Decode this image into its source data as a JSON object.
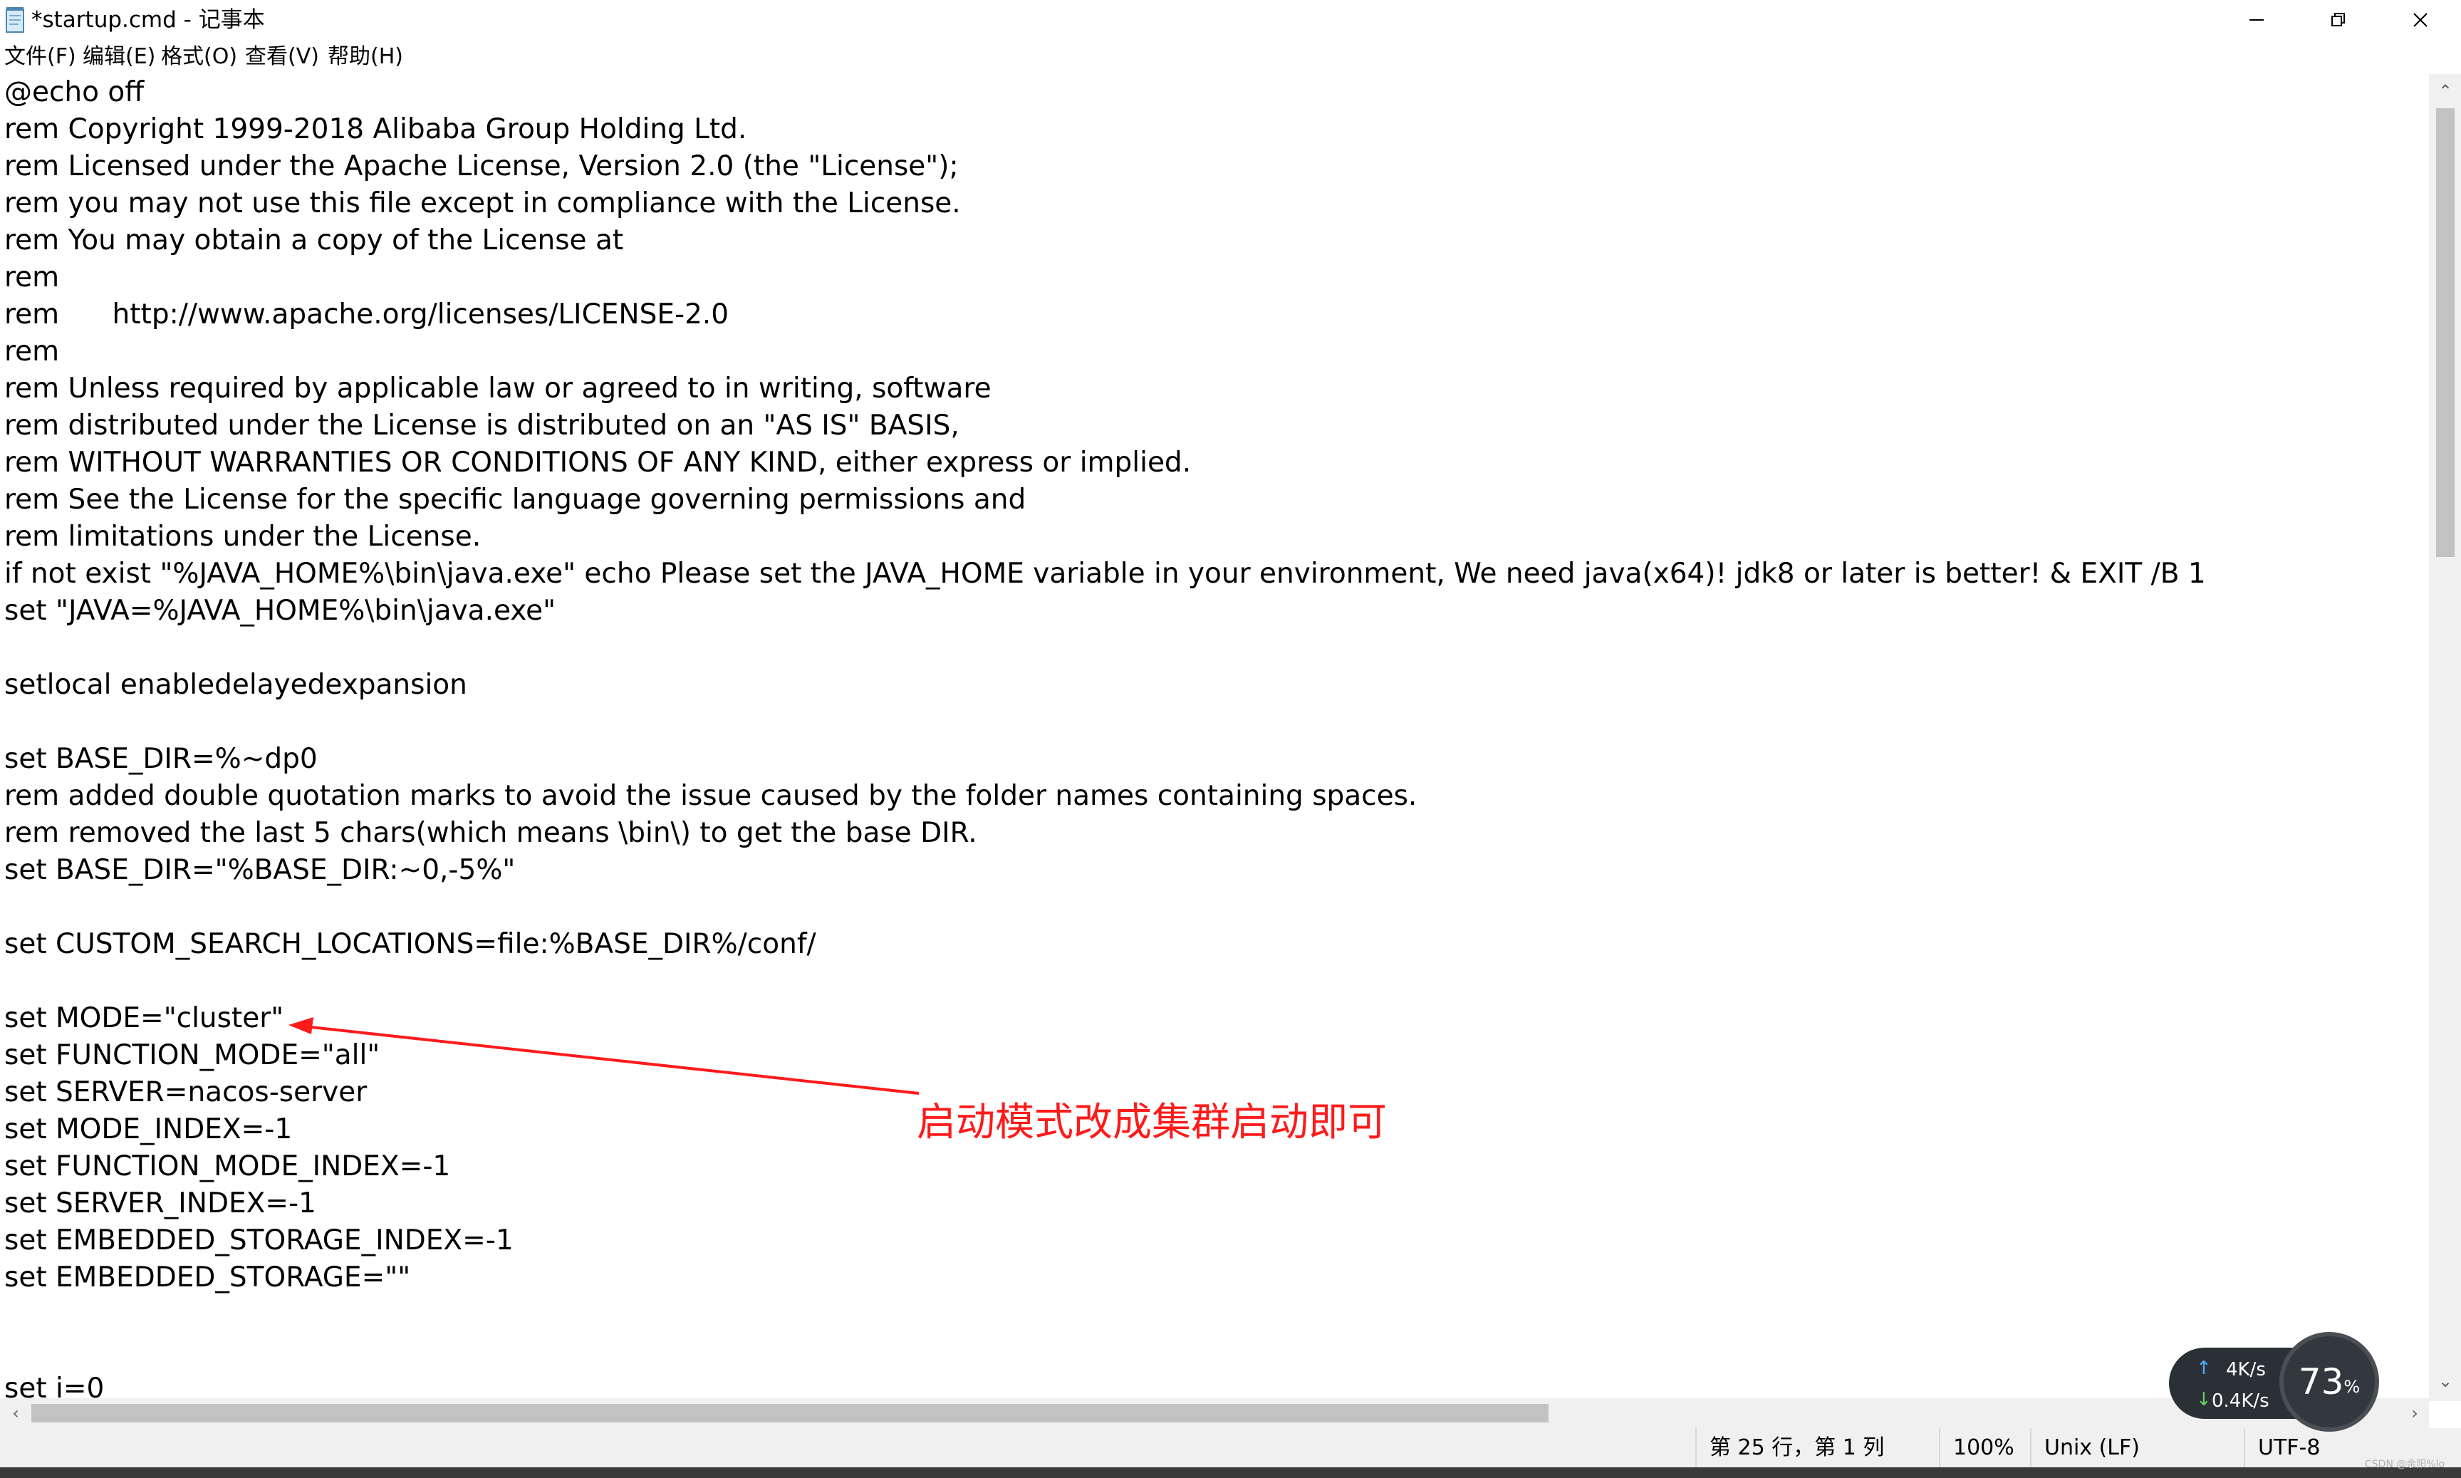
{
  "window": {
    "title": "*startup.cmd - 记事本",
    "minimize_glyph": "—",
    "maximize_glyph": "❐",
    "close_glyph": "✕"
  },
  "menu": {
    "items": [
      "文件(F)",
      "编辑(E)",
      "格式(O)",
      "查看(V)",
      "帮助(H)"
    ]
  },
  "editor": {
    "lines": [
      "@echo off",
      "rem Copyright 1999-2018 Alibaba Group Holding Ltd.",
      "rem Licensed under the Apache License, Version 2.0 (the \"License\");",
      "rem you may not use this file except in compliance with the License.",
      "rem You may obtain a copy of the License at",
      "rem",
      "rem      http://www.apache.org/licenses/LICENSE-2.0",
      "rem",
      "rem Unless required by applicable law or agreed to in writing, software",
      "rem distributed under the License is distributed on an \"AS IS\" BASIS,",
      "rem WITHOUT WARRANTIES OR CONDITIONS OF ANY KIND, either express or implied.",
      "rem See the License for the specific language governing permissions and",
      "rem limitations under the License.",
      "if not exist \"%JAVA_HOME%\\bin\\java.exe\" echo Please set the JAVA_HOME variable in your environment, We need java(x64)! jdk8 or later is better! & EXIT /B 1",
      "set \"JAVA=%JAVA_HOME%\\bin\\java.exe\"",
      "",
      "setlocal enabledelayedexpansion",
      "",
      "set BASE_DIR=%~dp0",
      "rem added double quotation marks to avoid the issue caused by the folder names containing spaces.",
      "rem removed the last 5 chars(which means \\bin\\) to get the base DIR.",
      "set BASE_DIR=\"%BASE_DIR:~0,-5%\"",
      "",
      "set CUSTOM_SEARCH_LOCATIONS=file:%BASE_DIR%/conf/",
      "",
      "set MODE=\"cluster\"",
      "set FUNCTION_MODE=\"all\"",
      "set SERVER=nacos-server",
      "set MODE_INDEX=-1",
      "set FUNCTION_MODE_INDEX=-1",
      "set SERVER_INDEX=-1",
      "set EMBEDDED_STORAGE_INDEX=-1",
      "set EMBEDDED_STORAGE=\"\"",
      "",
      "",
      "set i=0"
    ]
  },
  "annotation": {
    "text": "启动模式改成集群启动即可",
    "color": "#ff1a1a"
  },
  "status": {
    "position": "第 25 行，第 1 列",
    "zoom": "100%",
    "line_ending": "Unix (LF)",
    "encoding": "UTF-8"
  },
  "net_monitor": {
    "upload": "4K/s",
    "download": "0.4K/s",
    "percent": "73",
    "percent_sign": "%"
  },
  "watermark": "CSDN @余阳%lo"
}
